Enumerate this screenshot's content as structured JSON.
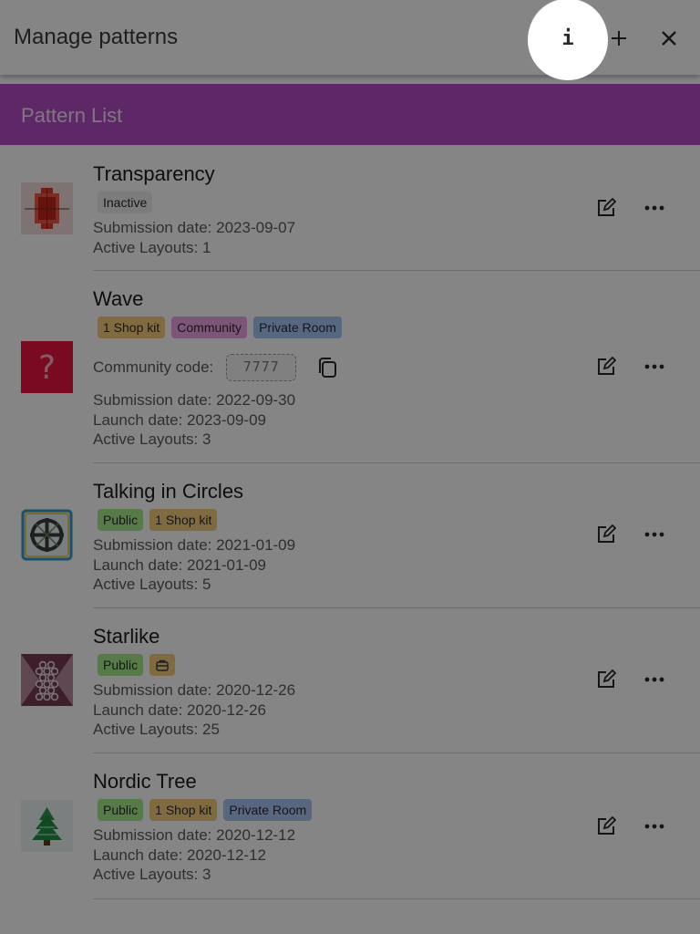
{
  "header": {
    "title": "Manage patterns",
    "info_label": "i",
    "add_icon": "plus-icon",
    "close_icon": "close-icon"
  },
  "banner": {
    "title": "Pattern List"
  },
  "colors": {
    "accent": "#b44ec7",
    "badge_inactive": "#eeeeee",
    "badge_shop_kit": "#f6cd7e",
    "badge_community": "#f0a3e6",
    "badge_private_room": "#a8c6f6",
    "badge_public": "#a6ea8a",
    "overlay": "rgba(0,0,0,0.48)"
  },
  "patterns": [
    {
      "name": "Transparency",
      "badges": [
        "Inactive"
      ],
      "submission": "Submission date: 2023-09-07",
      "active": "Active Layouts: 1"
    },
    {
      "name": "Wave",
      "badges": [
        "1 Shop kit",
        "Community",
        "Private Room"
      ],
      "code_label": "Community code:",
      "code_value": "7777",
      "submission": "Submission date: 2022-09-30",
      "launch": "Launch date: 2023-09-09",
      "active": "Active Layouts: 3"
    },
    {
      "name": "Talking in Circles",
      "badges": [
        "Public",
        "1 Shop kit"
      ],
      "submission": "Submission date: 2021-01-09",
      "launch": "Launch date: 2021-01-09",
      "active": "Active Layouts: 5"
    },
    {
      "name": "Starlike",
      "badges": [
        "Public"
      ],
      "submission": "Submission date: 2020-12-26",
      "launch": "Launch date: 2020-12-26",
      "active": "Active Layouts: 25"
    },
    {
      "name": "Nordic Tree",
      "badges": [
        "Public",
        "1 Shop kit",
        "Private Room"
      ],
      "submission": "Submission date: 2020-12-12",
      "launch": "Launch date: 2020-12-12",
      "active": "Active Layouts: 3"
    }
  ],
  "icons": {
    "edit": "edit-icon",
    "more": "more-horizontal-icon",
    "copy": "copy-icon",
    "kit": "shop-kit-icon"
  }
}
